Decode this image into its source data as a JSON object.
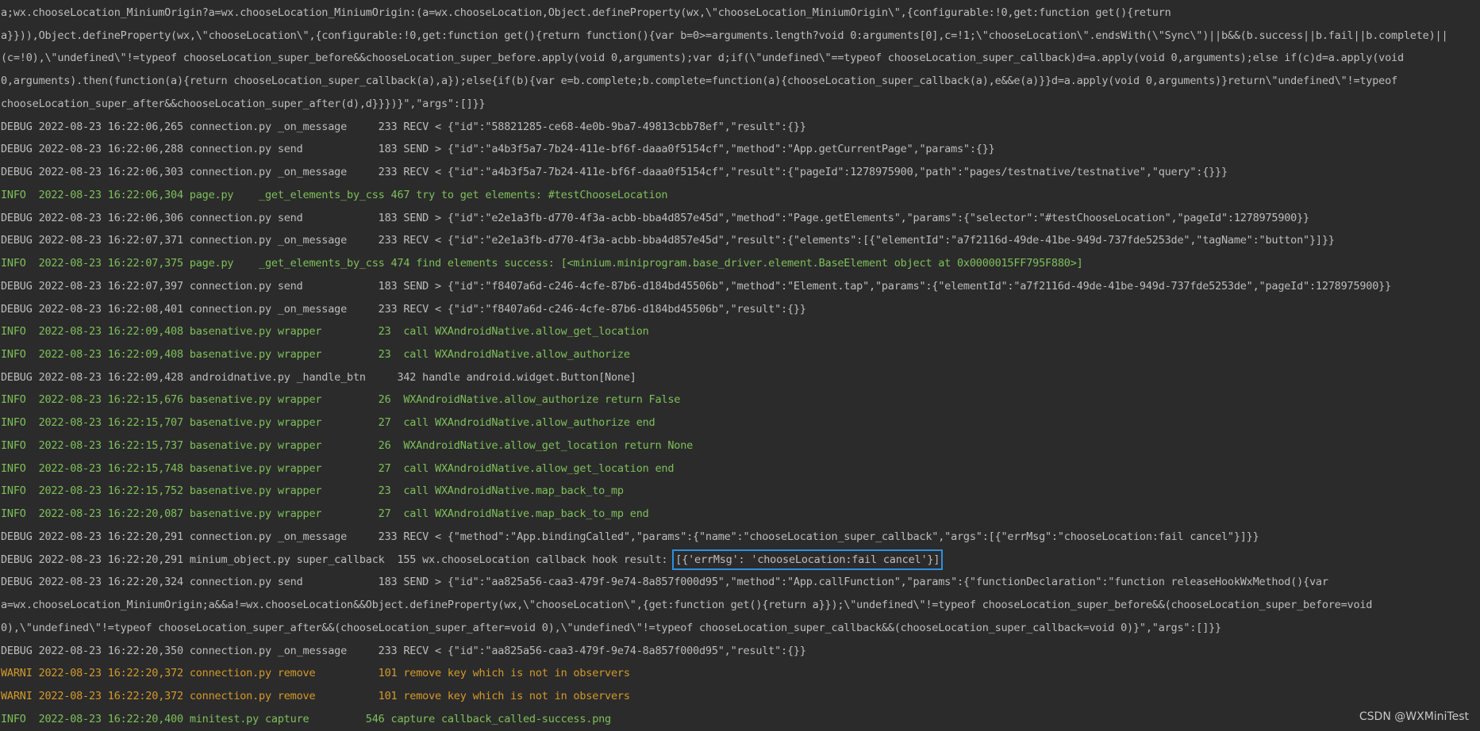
{
  "colors": {
    "background": "#2b2b2b",
    "debug": "#bdbdbd",
    "info": "#7ec05a",
    "warn": "#d49a2a",
    "highlight_border": "#2d8fe0"
  },
  "lines": [
    {
      "level": "CONT",
      "text": "a;wx.chooseLocation_MiniumOrigin?a=wx.chooseLocation_MiniumOrigin:(a=wx.chooseLocation,Object.defineProperty(wx,\\\"chooseLocation_MiniumOrigin\\\",{configurable:!0,get:function get(){return"
    },
    {
      "level": "CONT",
      "text": "a}})),Object.defineProperty(wx,\\\"chooseLocation\\\",{configurable:!0,get:function get(){return function(){var b=0>=arguments.length?void 0:arguments[0],c=!1;\\\"chooseLocation\\\".endsWith(\\\"Sync\\\")||b&&(b.success||b.fail||b.complete)||"
    },
    {
      "level": "CONT",
      "text": "(c=!0),\\\"undefined\\\"!=typeof chooseLocation_super_before&&chooseLocation_super_before.apply(void 0,arguments);var d;if(\\\"undefined\\\"==typeof chooseLocation_super_callback)d=a.apply(void 0,arguments);else if(c)d=a.apply(void"
    },
    {
      "level": "CONT",
      "text": "0,arguments).then(function(a){return chooseLocation_super_callback(a),a});else{if(b){var e=b.complete;b.complete=function(a){chooseLocation_super_callback(a),e&&e(a)}}d=a.apply(void 0,arguments)}return\\\"undefined\\\"!=typeof"
    },
    {
      "level": "CONT",
      "text": "chooseLocation_super_after&&chooseLocation_super_after(d),d}}})}\",\"args\":[]}}"
    },
    {
      "level": "DEBUG",
      "text": "DEBUG 2022-08-23 16:22:06,265 connection.py _on_message     233 RECV < {\"id\":\"58821285-ce68-4e0b-9ba7-49813cbb78ef\",\"result\":{}}"
    },
    {
      "level": "DEBUG",
      "text": "DEBUG 2022-08-23 16:22:06,288 connection.py send            183 SEND > {\"id\":\"a4b3f5a7-7b24-411e-bf6f-daaa0f5154cf\",\"method\":\"App.getCurrentPage\",\"params\":{}}"
    },
    {
      "level": "DEBUG",
      "text": "DEBUG 2022-08-23 16:22:06,303 connection.py _on_message     233 RECV < {\"id\":\"a4b3f5a7-7b24-411e-bf6f-daaa0f5154cf\",\"result\":{\"pageId\":1278975900,\"path\":\"pages/testnative/testnative\",\"query\":{}}}"
    },
    {
      "level": "INFO",
      "text": "INFO  2022-08-23 16:22:06,304 page.py    _get_elements_by_css 467 try to get elements: #testChooseLocation"
    },
    {
      "level": "DEBUG",
      "text": "DEBUG 2022-08-23 16:22:06,306 connection.py send            183 SEND > {\"id\":\"e2e1a3fb-d770-4f3a-acbb-bba4d857e45d\",\"method\":\"Page.getElements\",\"params\":{\"selector\":\"#testChooseLocation\",\"pageId\":1278975900}}"
    },
    {
      "level": "DEBUG",
      "text": "DEBUG 2022-08-23 16:22:07,371 connection.py _on_message     233 RECV < {\"id\":\"e2e1a3fb-d770-4f3a-acbb-bba4d857e45d\",\"result\":{\"elements\":[{\"elementId\":\"a7f2116d-49de-41be-949d-737fde5253de\",\"tagName\":\"button\"}]}}"
    },
    {
      "level": "INFO",
      "text": "INFO  2022-08-23 16:22:07,375 page.py    _get_elements_by_css 474 find elements success: [<minium.miniprogram.base_driver.element.BaseElement object at 0x0000015FF795F880>]"
    },
    {
      "level": "DEBUG",
      "text": "DEBUG 2022-08-23 16:22:07,397 connection.py send            183 SEND > {\"id\":\"f8407a6d-c246-4cfe-87b6-d184bd45506b\",\"method\":\"Element.tap\",\"params\":{\"elementId\":\"a7f2116d-49de-41be-949d-737fde5253de\",\"pageId\":1278975900}}"
    },
    {
      "level": "DEBUG",
      "text": "DEBUG 2022-08-23 16:22:08,401 connection.py _on_message     233 RECV < {\"id\":\"f8407a6d-c246-4cfe-87b6-d184bd45506b\",\"result\":{}}"
    },
    {
      "level": "INFO",
      "text": "INFO  2022-08-23 16:22:09,408 basenative.py wrapper         23  call WXAndroidNative.allow_get_location"
    },
    {
      "level": "INFO",
      "text": "INFO  2022-08-23 16:22:09,408 basenative.py wrapper         23  call WXAndroidNative.allow_authorize"
    },
    {
      "level": "DEBUG",
      "text": "DEBUG 2022-08-23 16:22:09,428 androidnative.py _handle_btn     342 handle android.widget.Button[None]"
    },
    {
      "level": "INFO",
      "text": "INFO  2022-08-23 16:22:15,676 basenative.py wrapper         26  WXAndroidNative.allow_authorize return False"
    },
    {
      "level": "INFO",
      "text": "INFO  2022-08-23 16:22:15,707 basenative.py wrapper         27  call WXAndroidNative.allow_authorize end"
    },
    {
      "level": "INFO",
      "text": "INFO  2022-08-23 16:22:15,737 basenative.py wrapper         26  WXAndroidNative.allow_get_location return None"
    },
    {
      "level": "INFO",
      "text": "INFO  2022-08-23 16:22:15,748 basenative.py wrapper         27  call WXAndroidNative.allow_get_location end"
    },
    {
      "level": "INFO",
      "text": "INFO  2022-08-23 16:22:15,752 basenative.py wrapper         23  call WXAndroidNative.map_back_to_mp"
    },
    {
      "level": "INFO",
      "text": "INFO  2022-08-23 16:22:20,087 basenative.py wrapper         27  call WXAndroidNative.map_back_to_mp end"
    },
    {
      "level": "DEBUG",
      "text": "DEBUG 2022-08-23 16:22:20,291 connection.py _on_message     233 RECV < {\"method\":\"App.bindingCalled\",\"params\":{\"name\":\"chooseLocation_super_callback\",\"args\":[{\"errMsg\":\"chooseLocation:fail cancel\"}]}}"
    },
    {
      "level": "DEBUG",
      "text": "DEBUG 2022-08-23 16:22:20,291 minium_object.py super_callback  155 wx.chooseLocation callback hook result: ",
      "highlight": "[{'errMsg': 'chooseLocation:fail cancel'}]"
    },
    {
      "level": "DEBUG",
      "text": "DEBUG 2022-08-23 16:22:20,324 connection.py send            183 SEND > {\"id\":\"aa825a56-caa3-479f-9e74-8a857f000d95\",\"method\":\"App.callFunction\",\"params\":{\"functionDeclaration\":\"function releaseHookWxMethod(){var"
    },
    {
      "level": "CONT",
      "text": "a=wx.chooseLocation_MiniumOrigin;a&&a!=wx.chooseLocation&&Object.defineProperty(wx,\\\"chooseLocation\\\",{get:function get(){return a}});\\\"undefined\\\"!=typeof chooseLocation_super_before&&(chooseLocation_super_before=void"
    },
    {
      "level": "CONT",
      "text": "0),\\\"undefined\\\"!=typeof chooseLocation_super_after&&(chooseLocation_super_after=void 0),\\\"undefined\\\"!=typeof chooseLocation_super_callback&&(chooseLocation_super_callback=void 0)}\",\"args\":[]}}"
    },
    {
      "level": "DEBUG",
      "text": "DEBUG 2022-08-23 16:22:20,350 connection.py _on_message     233 RECV < {\"id\":\"aa825a56-caa3-479f-9e74-8a857f000d95\",\"result\":{}}"
    },
    {
      "level": "WARNI",
      "text": "WARNI 2022-08-23 16:22:20,372 connection.py remove          101 remove key which is not in observers"
    },
    {
      "level": "WARNI",
      "text": "WARNI 2022-08-23 16:22:20,372 connection.py remove          101 remove key which is not in observers"
    },
    {
      "level": "INFO",
      "text": "INFO  2022-08-23 16:22:20,400 minitest.py capture         546 capture callback_called-success.png"
    }
  ],
  "watermark": "CSDN @WXMiniTest"
}
